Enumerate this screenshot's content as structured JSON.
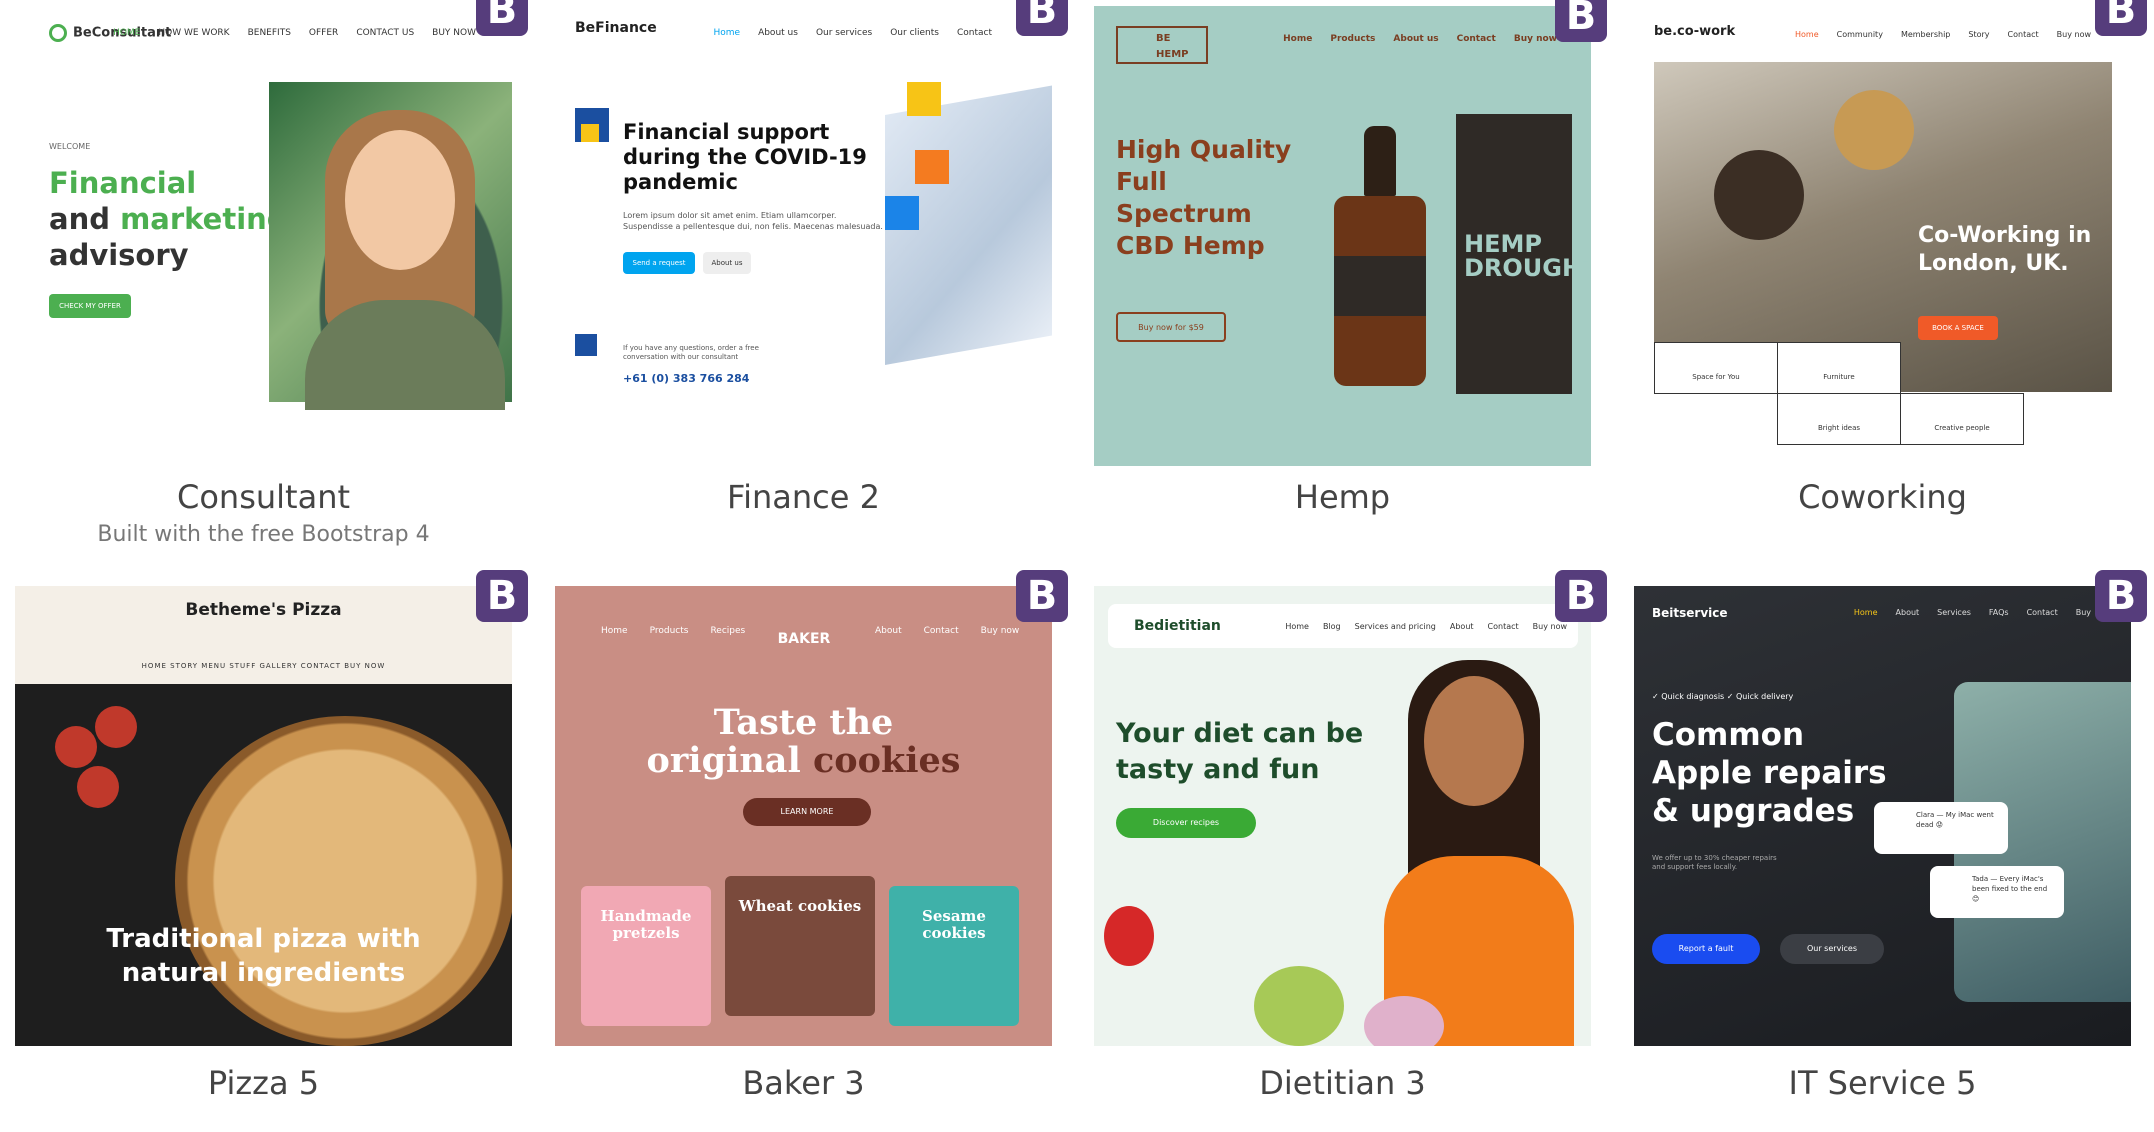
{
  "badge_label": "B",
  "cards": [
    {
      "title": "Consultant",
      "subtitle": "Built with the free Bootstrap 4",
      "thumb": {
        "logo": "BeConsultant",
        "nav": [
          "HOME",
          "HOW WE WORK",
          "BENEFITS",
          "OFFER",
          "CONTACT US",
          "BUY NOW"
        ],
        "welcome": "WELCOME",
        "hero_line1": "Financial",
        "hero_line2a": "and ",
        "hero_line2b": "marketing",
        "hero_line3": "advisory",
        "cta": "CHECK MY OFFER"
      }
    },
    {
      "title": "Finance 2",
      "thumb": {
        "logo": "BeFinance",
        "nav": [
          "Home",
          "About us",
          "Our services",
          "Our clients",
          "Contact"
        ],
        "hero": "Financial support during the COVID-19 pandemic",
        "para": "Lorem ipsum dolor sit amet enim. Etiam ullamcorper. Suspendisse a pellentesque dui, non felis. Maecenas malesuada.",
        "btn_primary": "Send a request",
        "btn_secondary": "About us",
        "question": "If you have any questions, order a free conversation with our consultant",
        "phone": "+61 (0) 383 766 284"
      }
    },
    {
      "title": "Hemp",
      "thumb": {
        "logo": "BE HEMP",
        "nav": [
          "Home",
          "Products",
          "About us",
          "Contact",
          "Buy now"
        ],
        "hero": "High Quality Full Spectrum CBD Hemp",
        "cta": "Buy now for $59",
        "box_text": "HEMP DROUGHT"
      }
    },
    {
      "title": "Coworking",
      "thumb": {
        "logo": "be.co-work",
        "nav": [
          "Home",
          "Community",
          "Membership",
          "Story",
          "Contact",
          "Buy now"
        ],
        "hero": "Co-Working in London, UK.",
        "cta": "BOOK A SPACE",
        "cells": [
          "Space for You",
          "Furniture",
          "Bright ideas",
          "Creative people"
        ]
      }
    },
    {
      "title": "Pizza 5",
      "thumb": {
        "logo": "Betheme's Pizza",
        "menu": "HOME   STORY   MENU   STUFF   GALLERY   CONTACT   BUY NOW",
        "hero": "Traditional pizza with natural ingredients"
      }
    },
    {
      "title": "Baker 3",
      "thumb": {
        "nav_left": [
          "Home",
          "Products",
          "Recipes"
        ],
        "logo": "BAKER",
        "nav_right": [
          "About",
          "Contact",
          "Buy now"
        ],
        "hero_a": "Taste the",
        "hero_b": "original ",
        "hero_c": "cookies",
        "cta": "LEARN MORE",
        "packs": [
          "Handmade pretzels",
          "Wheat cookies",
          "Sesame cookies"
        ]
      }
    },
    {
      "title": "Dietitian 3",
      "thumb": {
        "logo": "Bedietitian",
        "nav": [
          "Home",
          "Blog",
          "Services and pricing",
          "About",
          "Contact",
          "Buy now"
        ],
        "hero": "Your diet can be tasty and fun",
        "cta": "Discover recipes"
      }
    },
    {
      "title": "IT Service 5",
      "thumb": {
        "logo": "Beitservice",
        "nav": [
          "Home",
          "About",
          "Services",
          "FAQs",
          "Contact",
          "Buy"
        ],
        "ticks": "✓ Quick diagnosis     ✓ Quick delivery",
        "hero": "Common Apple repairs & upgrades",
        "para": "We offer up to 30% cheaper repairs and support fees locally.",
        "btn_primary": "Report a fault",
        "btn_secondary": "Our services",
        "chat1": "Clara — My iMac went dead 😟",
        "chat2": "Tada — Every iMac's been fixed to the end 😊"
      }
    }
  ]
}
